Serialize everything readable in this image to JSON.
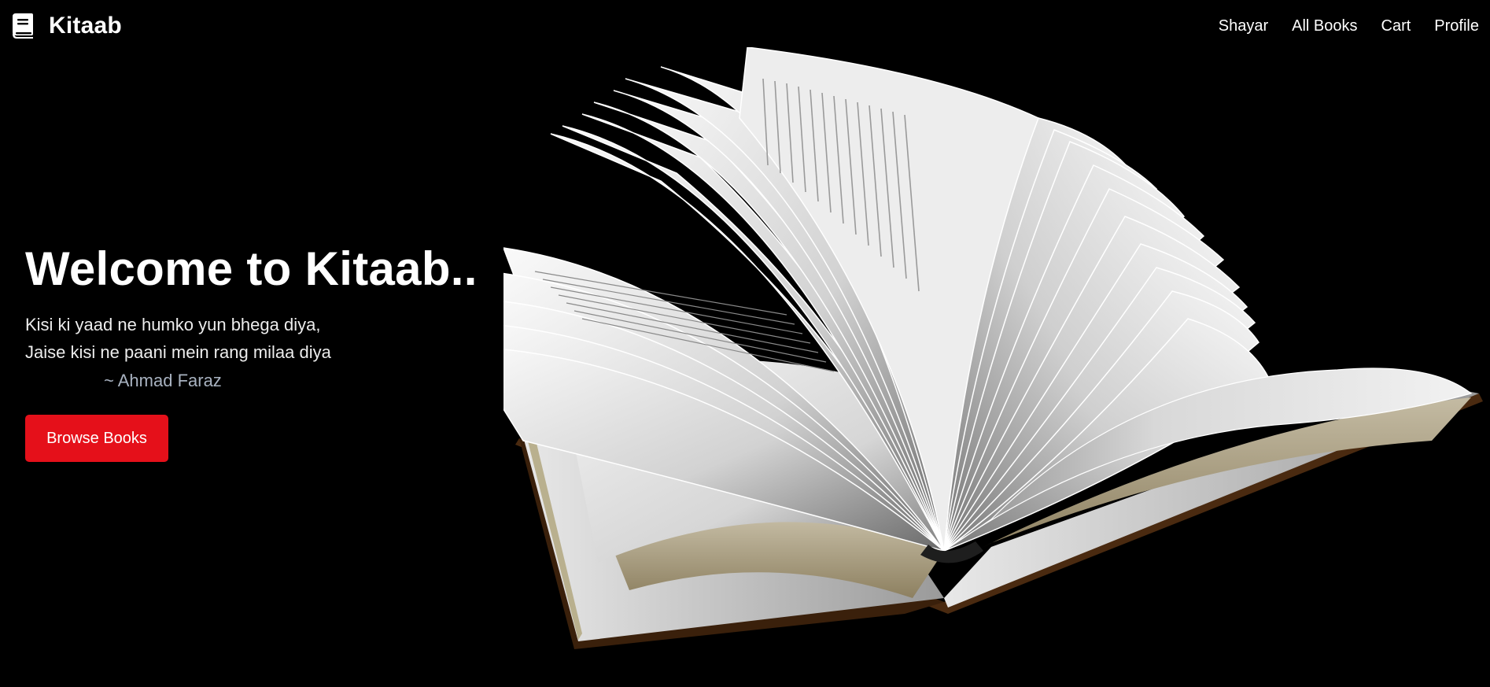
{
  "navbar": {
    "brand": {
      "name": "Kitaab",
      "icon": "book-icon"
    },
    "links": [
      {
        "label": "Shayar"
      },
      {
        "label": "All Books"
      },
      {
        "label": "Cart"
      },
      {
        "label": "Profile"
      }
    ]
  },
  "hero": {
    "title": "Welcome to Kitaab..",
    "quote": {
      "line1": "Kisi ki yaad ne humko yun bhega diya,",
      "line2": "Jaise kisi ne paani mein rang milaa diya",
      "author": "~ Ahmad Faraz"
    },
    "cta": {
      "label": "Browse Books"
    }
  },
  "illustration": {
    "icon": "open-book-image"
  },
  "colors": {
    "background": "#000000",
    "text": "#ffffff",
    "accent": "#e5101a",
    "author": "#a8b2c0"
  }
}
